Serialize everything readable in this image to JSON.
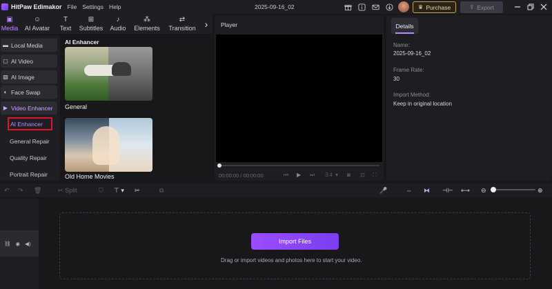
{
  "titlebar": {
    "app_name": "HitPaw Edimakor",
    "menus": [
      "File",
      "Settings",
      "Help"
    ],
    "project_name": "2025-09-16_02",
    "purchase_label": "Purchase",
    "export_label": "Export"
  },
  "toolbar": {
    "tabs": [
      {
        "label": "Media",
        "icon": "media-icon",
        "active": true
      },
      {
        "label": "AI Avatar",
        "icon": "ai-avatar-icon",
        "active": false
      },
      {
        "label": "Text",
        "icon": "text-icon",
        "active": false
      },
      {
        "label": "Subtitles",
        "icon": "subtitles-icon",
        "active": false
      },
      {
        "label": "Audio",
        "icon": "audio-icon",
        "active": false
      },
      {
        "label": "Elements",
        "icon": "elements-icon",
        "active": false
      },
      {
        "label": "Transition",
        "icon": "transition-icon",
        "active": false
      }
    ]
  },
  "sidebar": {
    "items": [
      {
        "label": "Local Media",
        "icon": "folder-icon"
      },
      {
        "label": "AI Video",
        "icon": "ai-video-icon"
      },
      {
        "label": "AI Image",
        "icon": "ai-image-icon"
      },
      {
        "label": "Face Swap",
        "icon": "face-swap-icon"
      },
      {
        "label": "Video Enhancer",
        "icon": "video-enhancer-icon"
      }
    ],
    "sub_items": [
      "AI Enhancer",
      "General Repair",
      "Quality Repair",
      "Portrait Repair"
    ],
    "selected_sub_item": "AI Enhancer"
  },
  "media_panel": {
    "title": "AI Enhancer",
    "cards": [
      {
        "label": "General"
      },
      {
        "label": "Old Home Movies"
      }
    ]
  },
  "player": {
    "title": "Player",
    "time": "00:00:00 / 00:00:00",
    "aspect": "3:4"
  },
  "details": {
    "tab_label": "Details",
    "fields": [
      {
        "label": "Name:",
        "value": "2025-09-16_02"
      },
      {
        "label": "Frame Rate:",
        "value": "30"
      },
      {
        "label": "Import Method:",
        "value": "Keep in original location"
      }
    ]
  },
  "timeline": {
    "split_label": "Split",
    "import_button": "Import Files",
    "drop_hint": "Drag or import videos and photos here to start your video."
  },
  "colors": {
    "accent": "#b98bff",
    "import_button": "#8a45f8",
    "highlight_box": "#e3132a",
    "purchase_border": "#c9a34f"
  }
}
